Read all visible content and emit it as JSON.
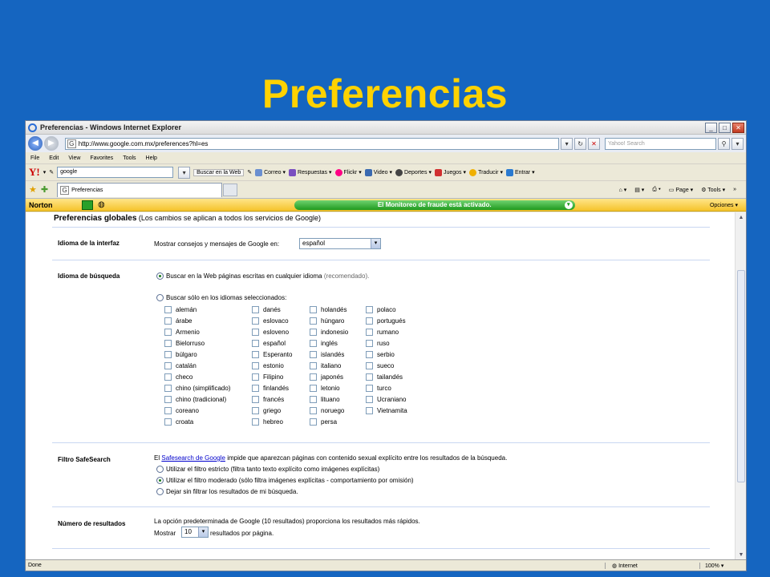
{
  "slide": {
    "title": "Preferencias"
  },
  "window": {
    "title": "Preferencias - Windows Internet Explorer",
    "buttons": {
      "minimize": "_",
      "maximize": "□",
      "close": "✕"
    }
  },
  "address": {
    "url": "http://www.google.com.mx/preferences?hl=es",
    "search_placeholder": "Yahoo! Search"
  },
  "menu": [
    "File",
    "Edit",
    "View",
    "Favorites",
    "Tools",
    "Help"
  ],
  "yahoo_toolbar": {
    "search_value": "google",
    "search_button": "Buscar en la Web",
    "items": [
      "Correo",
      "Respuestas",
      "Flickr",
      "Video",
      "Deportes",
      "Juegos",
      "Traducir",
      "Entrar"
    ]
  },
  "tabs": {
    "active": "Preferencias"
  },
  "commands": {
    "page": "Page",
    "tools": "Tools"
  },
  "norton": {
    "logo": "Norton",
    "status": "El Monitoreo de fraude está activado.",
    "options": "Opciones"
  },
  "prefs": {
    "global_title": "Preferencias globales",
    "global_note": "(Los cambios se aplican a todos los servicios de Google)",
    "interface": {
      "label": "Idioma de la interfaz",
      "text": "Mostrar consejos y mensajes de Google en:",
      "value": "español"
    },
    "search_lang": {
      "label": "Idioma de búsqueda",
      "opt_all": "Buscar en la Web páginas escritas en cualquier idioma",
      "opt_all_note": "(recomendado).",
      "opt_selected": "Buscar sólo en los idiomas seleccionados:",
      "col1": [
        "alemán",
        "árabe",
        "Armenio",
        "Bielorruso",
        "búlgaro",
        "catalán",
        "checo",
        "chino (simplificado)",
        "chino (tradicional)",
        "coreano",
        "croata"
      ],
      "col2": [
        "danés",
        "eslovaco",
        "esloveno",
        "español",
        "Esperanto",
        "estonio",
        "Filipino",
        "finlandés",
        "francés",
        "griego",
        "hebreo"
      ],
      "col3": [
        "holandés",
        "húngaro",
        "indonesio",
        "inglés",
        "islandés",
        "italiano",
        "japonés",
        "letonio",
        "lituano",
        "noruego",
        "persa"
      ],
      "col4": [
        "polaco",
        "portugués",
        "rumano",
        "ruso",
        "serbio",
        "sueco",
        "tailandés",
        "turco",
        "Ucraniano",
        "Vietnamita"
      ]
    },
    "safesearch": {
      "label": "Filtro SafeSearch",
      "intro_pre": "El",
      "intro_link": "Safesearch de Google",
      "intro_post": "impide que aparezcan páginas con contenido sexual explícito entre los resultados de la búsqueda.",
      "opt_strict": "Utilizar el filtro estricto (filtra tanto texto explícito como imágenes explícitas)",
      "opt_moderate": "Utilizar el filtro moderado (sólo filtra imágenes explícitas - comportamiento por omisión)",
      "opt_off": "Dejar sin filtrar los resultados de mi búsqueda."
    },
    "results": {
      "label": "Número de resultados",
      "text": "La opción predeterminada de Google (10 resultados) proporciona los resultados más rápidos.",
      "show": "Mostrar",
      "value": "10",
      "suffix": "resultados por página."
    }
  },
  "status": {
    "left": "Done",
    "zone": "Internet",
    "zoom": "100%"
  }
}
